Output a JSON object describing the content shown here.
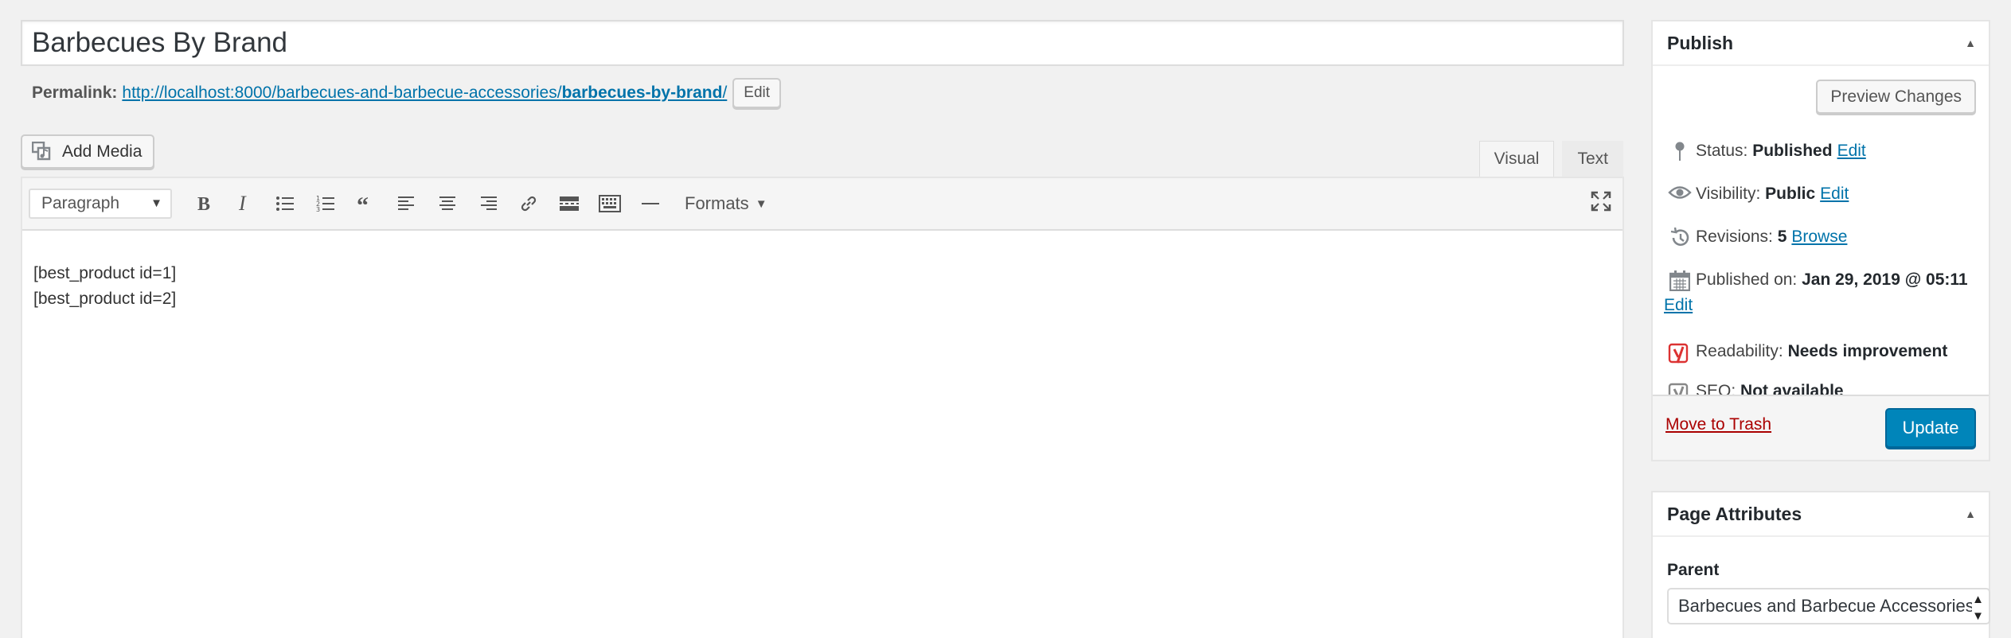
{
  "post": {
    "title": "Barbecues By Brand",
    "permalink_label": "Permalink:",
    "permalink_base": "http://localhost:8000/barbecues-and-barbecue-accessories/",
    "permalink_slug": "barbecues-by-brand",
    "permalink_trailing": "/",
    "permalink_edit": "Edit"
  },
  "editor": {
    "add_media": "Add Media",
    "tabs": [
      "Visual",
      "Text"
    ],
    "active_tab": "Visual",
    "format_select": "Paragraph",
    "formats_menu": "Formats",
    "content_lines": [
      "[best_product id=1]",
      "[best_product id=2]"
    ],
    "toolbar_icons": [
      "bold-icon",
      "italic-icon",
      "bulleted-list-icon",
      "numbered-list-icon",
      "blockquote-icon",
      "align-left-icon",
      "align-center-icon",
      "align-right-icon",
      "link-icon",
      "read-more-icon",
      "toolbar-toggle-icon",
      "horizontal-line-icon"
    ]
  },
  "publish": {
    "title": "Publish",
    "preview": "Preview Changes",
    "status_label": "Status:",
    "status_value": "Published",
    "status_edit": "Edit",
    "visibility_label": "Visibility:",
    "visibility_value": "Public",
    "visibility_edit": "Edit",
    "revisions_label": "Revisions:",
    "revisions_value": "5",
    "revisions_link": "Browse",
    "published_label": "Published on:",
    "published_value": "Jan 29, 2019 @ 05:11",
    "published_edit": "Edit",
    "readability_label": "Readability:",
    "readability_value": "Needs improvement",
    "seo_label": "SEO:",
    "seo_value": "Not available",
    "trash": "Move to Trash",
    "update": "Update"
  },
  "page_attributes": {
    "title": "Page Attributes",
    "parent_label": "Parent",
    "parent_value": "Barbecues and Barbecue Accessories"
  },
  "colors": {
    "link": "#0073aa",
    "primary_button": "#0085ba",
    "trash": "#a00",
    "readability_bad": "#dc3232"
  }
}
